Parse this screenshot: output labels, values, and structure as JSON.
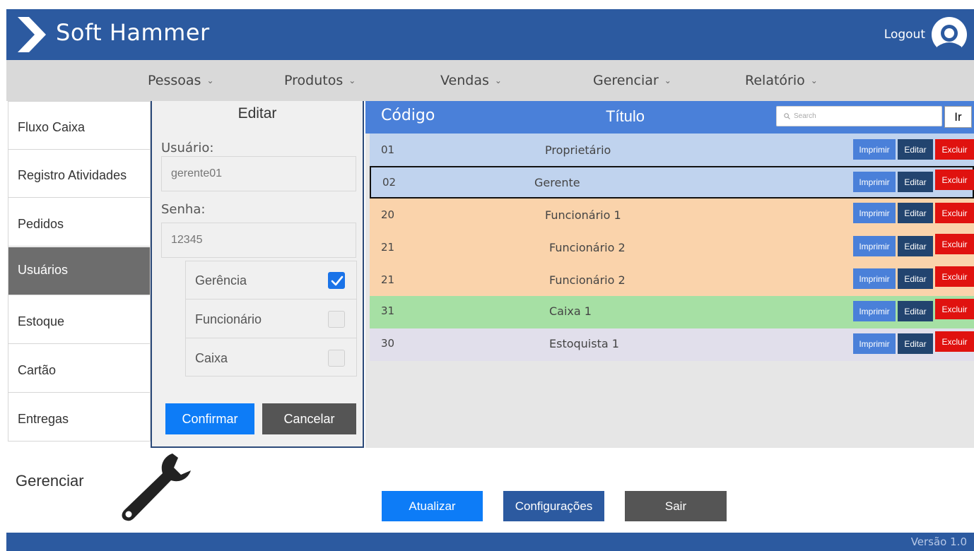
{
  "header": {
    "app_title": "Soft Hammer",
    "logout_label": "Logout",
    "logo_icon": "chevron-right-icon",
    "avatar_icon": "user-avatar-icon"
  },
  "nav": {
    "items": [
      {
        "label": "Pessoas"
      },
      {
        "label": "Produtos"
      },
      {
        "label": "Vendas"
      },
      {
        "label": "Gerenciar"
      },
      {
        "label": "Relatório"
      }
    ],
    "chevron": "⌄"
  },
  "sidebar": {
    "active_item": "Usuários",
    "items": [
      {
        "label": "Fluxo Caixa"
      },
      {
        "label": "Registro Atividades"
      },
      {
        "label": "Pedidos"
      },
      {
        "label": "Usuários"
      },
      {
        "label": "Estoque"
      },
      {
        "label": "Cartão"
      },
      {
        "label": "Entregas"
      }
    ]
  },
  "edit_panel": {
    "title": "Editar",
    "user_label": "Usuário:",
    "user_placeholder": "gerente01",
    "password_label": "Senha:",
    "password_placeholder": "12345",
    "roles": [
      {
        "label": "Gerência",
        "checked": true
      },
      {
        "label": "Funcionário",
        "checked": false
      },
      {
        "label": "Caixa",
        "checked": false
      }
    ],
    "confirm_label": "Confirmar",
    "cancel_label": "Cancelar"
  },
  "table": {
    "code_header": "Código",
    "title_header": "Título",
    "search_placeholder": "Search",
    "go_label": "Ir",
    "actions": {
      "print": "Imprimir",
      "edit": "Editar",
      "delete": "Excluir"
    },
    "selected_code": "02",
    "rows": [
      {
        "code": "01",
        "title": "Proprietário",
        "color": "#c0d3ee"
      },
      {
        "code": "02",
        "title": "Gerente",
        "color": "#c0d3ee"
      },
      {
        "code": "20",
        "title": "Funcionário 1",
        "color": "#fad3ab"
      },
      {
        "code": "21",
        "title": "Funcionário 2",
        "color": "#fad3ab"
      },
      {
        "code": "21",
        "title": "Funcionário 2",
        "color": "#fad3ab"
      },
      {
        "code": "31",
        "title": "Caixa 1",
        "color": "#a6e0a4"
      },
      {
        "code": "30",
        "title": "Estoquista 1",
        "color": "#e1dfeb"
      }
    ]
  },
  "bottom": {
    "manage_label": "Gerenciar",
    "wrench_icon": "wrench-icon",
    "refresh_label": "Atualizar",
    "settings_label": "Configurações",
    "exit_label": "Sair"
  },
  "footer": {
    "version": "Versão 1.0"
  },
  "colors": {
    "primary": "#2c5aa0",
    "accent_blue": "#0d7cf7",
    "table_header": "#4a80d9",
    "delete_red": "#e0120f"
  }
}
